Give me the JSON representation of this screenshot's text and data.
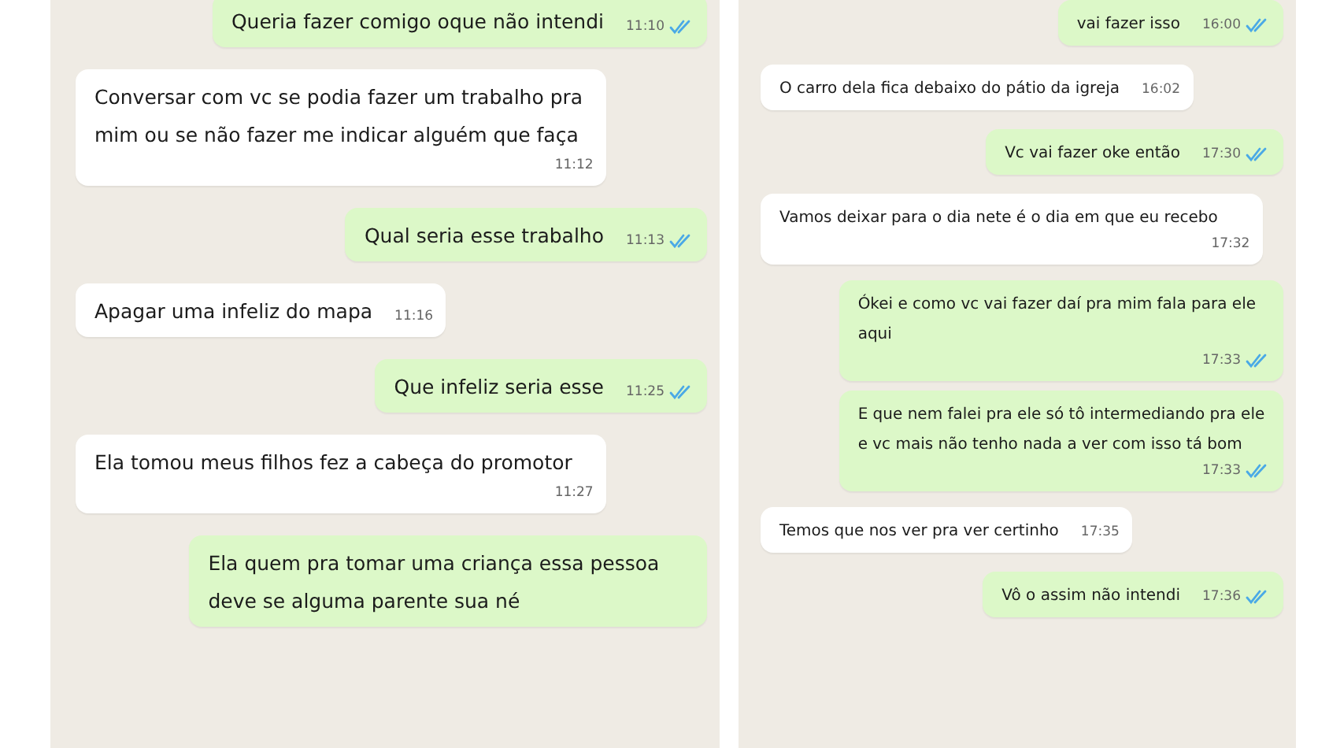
{
  "panels": [
    {
      "messages": [
        {
          "kind": "out",
          "text": "Queria fazer comigo oque não intendi",
          "time": "11:10",
          "read": true
        },
        {
          "kind": "in",
          "text": "Conversar com vc se podia fazer um trabalho pra mim ou se não fazer me indicar alguém que faça",
          "time": "11:12"
        },
        {
          "kind": "out",
          "text": "Qual seria esse trabalho",
          "time": "11:13",
          "read": true
        },
        {
          "kind": "in",
          "text": "Apagar uma infeliz do mapa",
          "time": "11:16"
        },
        {
          "kind": "out",
          "text": "Que infeliz seria esse",
          "time": "11:25",
          "read": true
        },
        {
          "kind": "in",
          "text": "Ela tomou meus filhos fez a cabeça do promotor",
          "time": "11:27"
        },
        {
          "kind": "out",
          "text": "Ela quem pra tomar uma criança essa pessoa deve se alguma parente sua né"
        }
      ]
    },
    {
      "messages": [
        {
          "kind": "out",
          "text": "vai fazer isso",
          "time": "16:00",
          "read": true
        },
        {
          "kind": "in",
          "text": "O carro dela fica debaixo do pátio da igreja",
          "time": "16:02"
        },
        {
          "kind": "out",
          "text": "Vc vai fazer oke então",
          "time": "17:30",
          "read": true
        },
        {
          "kind": "in",
          "text": "Vamos deixar para o dia nete é o dia em que eu recebo",
          "time": "17:32"
        },
        {
          "kind": "out",
          "text": "Ókei e como vc vai fazer daí pra mim fala para ele aqui",
          "time": "17:33",
          "read": true
        },
        {
          "kind": "out",
          "text": "E que nem falei pra ele só tô intermediando pra ele e vc mais não tenho nada a ver com isso tá bom",
          "time": "17:33",
          "read": true
        },
        {
          "kind": "in",
          "text": "Temos que nos ver pra ver certinho",
          "time": "17:35"
        },
        {
          "kind": "out",
          "text": "Vô o assim não intendi",
          "time": "17:36",
          "read": true
        }
      ]
    }
  ]
}
